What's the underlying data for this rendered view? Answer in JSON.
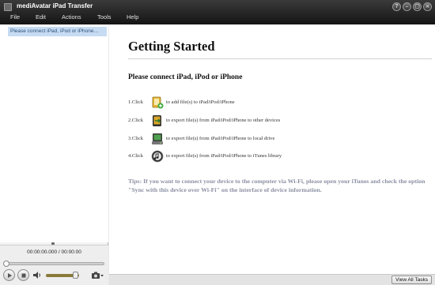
{
  "window": {
    "title": "mediAvatar iPad Transfer",
    "controls": [
      "?",
      "–",
      "▢",
      "×"
    ]
  },
  "menu": [
    "File",
    "Edit",
    "Actions",
    "Tools",
    "Help"
  ],
  "sidebar": {
    "device_item": "Please connect iPad, iPod or iPhone..."
  },
  "player": {
    "timecode": "00:00:00.000 / 00:00:00",
    "volume_level": 0.9
  },
  "main": {
    "title": "Getting Started",
    "subtitle": "Please connect iPad, iPod or iPhone",
    "steps": [
      {
        "num": "1.Click",
        "icon": "add-file-icon",
        "text": "to add file(s) to iPad/iPod/iPhone"
      },
      {
        "num": "2.Click",
        "icon": "export-to-device-icon",
        "text": "to export file(s) from iPad/iPod/iPhone to other devices"
      },
      {
        "num": "3.Click",
        "icon": "export-to-drive-icon",
        "text": "to export file(s) from iPad/iPod/iPhone to local drive"
      },
      {
        "num": "4.Click",
        "icon": "itunes-icon",
        "text": "to export file(s) from iPad/iPod/iPhone to iTunes library"
      }
    ],
    "tips": "Tips: If you want to connect your device to the computer via Wi-Fi, please open your iTunes and check the option \"Sync with this device over Wi-Fi\" on the interface of device information."
  },
  "statusbar": {
    "view_all_label": "View All Tasks"
  },
  "colors": {
    "title_bg": "#1e1e1e",
    "selected_row": "#c6dcf3",
    "tips_text": "#8b91a3"
  }
}
